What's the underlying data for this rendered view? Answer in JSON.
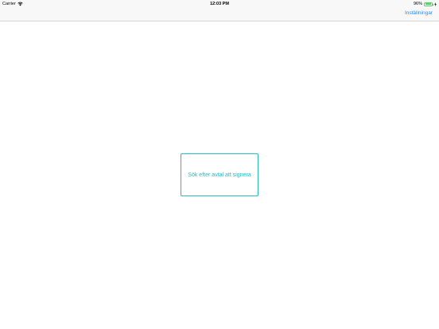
{
  "status_bar": {
    "carrier": "Carrier",
    "time": "12:03 PM",
    "battery_percent": "96%",
    "battery_level": 0.96,
    "wifi_icon": "wifi-icon",
    "battery_icon": "battery-icon",
    "charge_icon": "charging-bolt-icon"
  },
  "nav_bar": {
    "settings_label": "Inställningar"
  },
  "main": {
    "search_button_label": "Sök efter avtal att signera"
  },
  "colors": {
    "accent_blue": "#1a8cff",
    "teal": "#25b8c5",
    "battery_green": "#4cd964"
  }
}
